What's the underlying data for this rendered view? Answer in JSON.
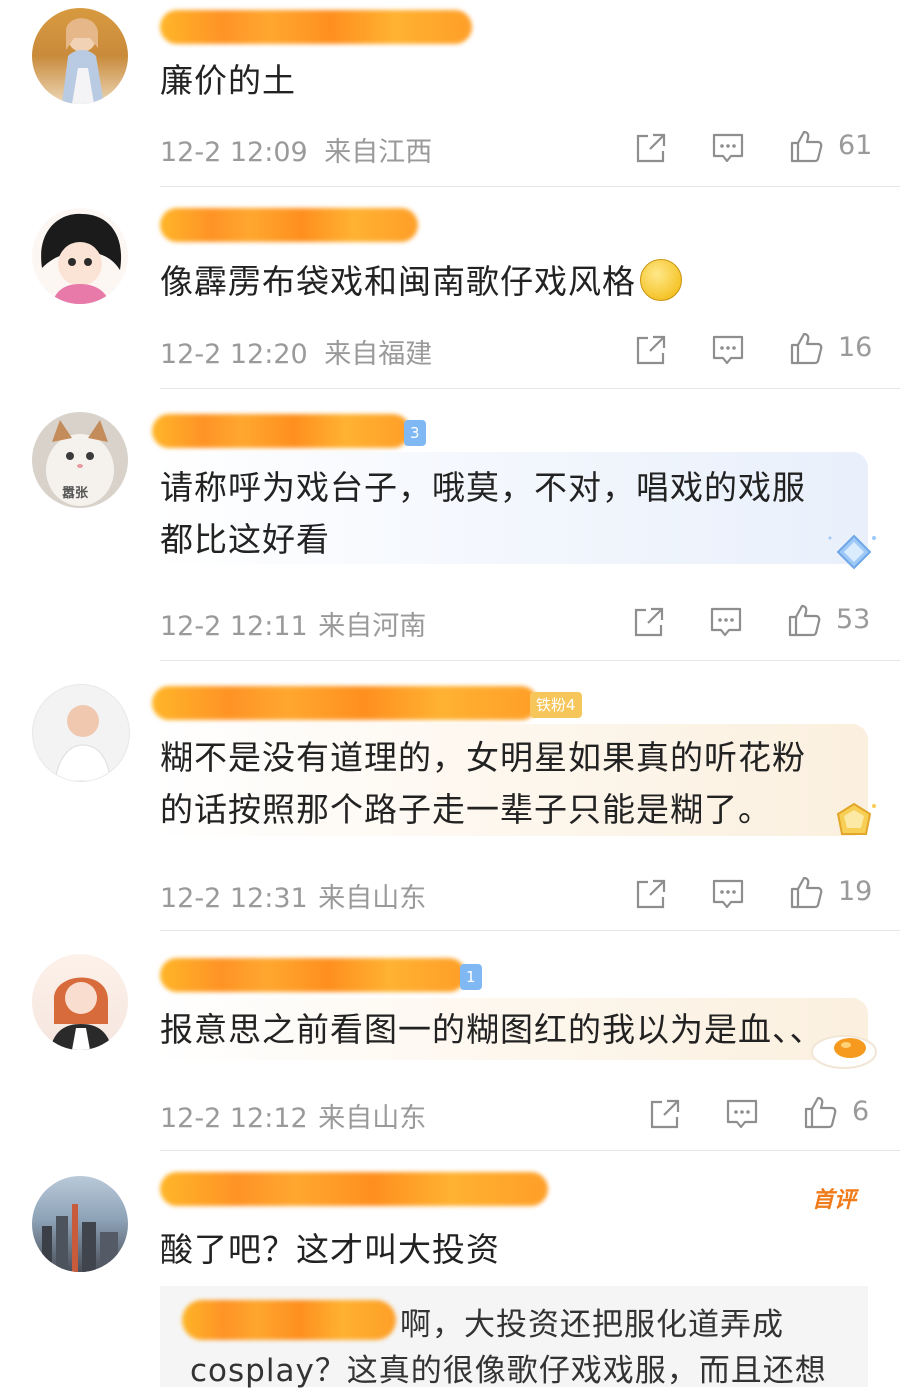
{
  "comments": [
    {
      "text": "廉价的土",
      "time": "12-2 12:09",
      "location": "来自江西",
      "likes": "61"
    },
    {
      "text": "像霹雳布袋戏和闽南歌仔戏风格",
      "time": "12-2 12:20",
      "location": "来自福建",
      "likes": "16"
    },
    {
      "text_line1": "请称呼为戏台子，哦莫，不对，唱戏的戏服",
      "text_line2": "都比这好看",
      "time": "12-2 12:11",
      "location": "来自河南",
      "likes": "53",
      "badge": "3"
    },
    {
      "text_line1": "糊不是没有道理的，女明星如果真的听花粉",
      "text_line2": "的话按照那个路子走一辈子只能是糊了。",
      "time": "12-2 12:31",
      "location": "来自山东",
      "likes": "19",
      "badge": "铁粉4"
    },
    {
      "text": "报意思之前看图一的糊图红的我以为是血、、",
      "time": "12-2 12:12",
      "location": "来自山东",
      "likes": "6",
      "badge": "1"
    },
    {
      "text": "酸了吧？这才叫大投资",
      "tag": "首评",
      "quote_line1": "啊，大投资还把服化道弄成",
      "quote_line2": "cosplay？这真的很像歌仔戏戏服，而且还想"
    }
  ],
  "avatar_texts": {
    "cat": "嚣张"
  },
  "icons": {
    "share": "share-icon",
    "comment": "comment-icon",
    "like": "thumbs-up-icon"
  },
  "colors": {
    "blur": "#ff9a1d",
    "meta": "#9a9a9a",
    "text": "#222222",
    "divider": "#e6e6e6"
  }
}
